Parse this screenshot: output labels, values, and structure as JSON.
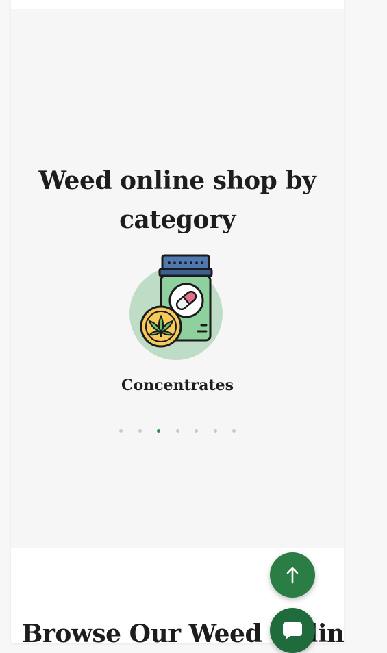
{
  "category_section": {
    "title": "Weed online shop by category",
    "active_category": {
      "label": "Concentrates",
      "icon": "concentrates-jar-icon"
    },
    "carousel": {
      "total_dots": 7,
      "active_index": 2
    }
  },
  "browse_section": {
    "title": "Browse Our Weed Online"
  },
  "floating_buttons": {
    "back_to_top_icon": "arrow-up-icon",
    "chat_icon": "chat-bubble-icon"
  },
  "colors": {
    "accent_green": "#2e8b50",
    "button_green": "#2b7d46",
    "text_dark": "#1d1d1d"
  }
}
